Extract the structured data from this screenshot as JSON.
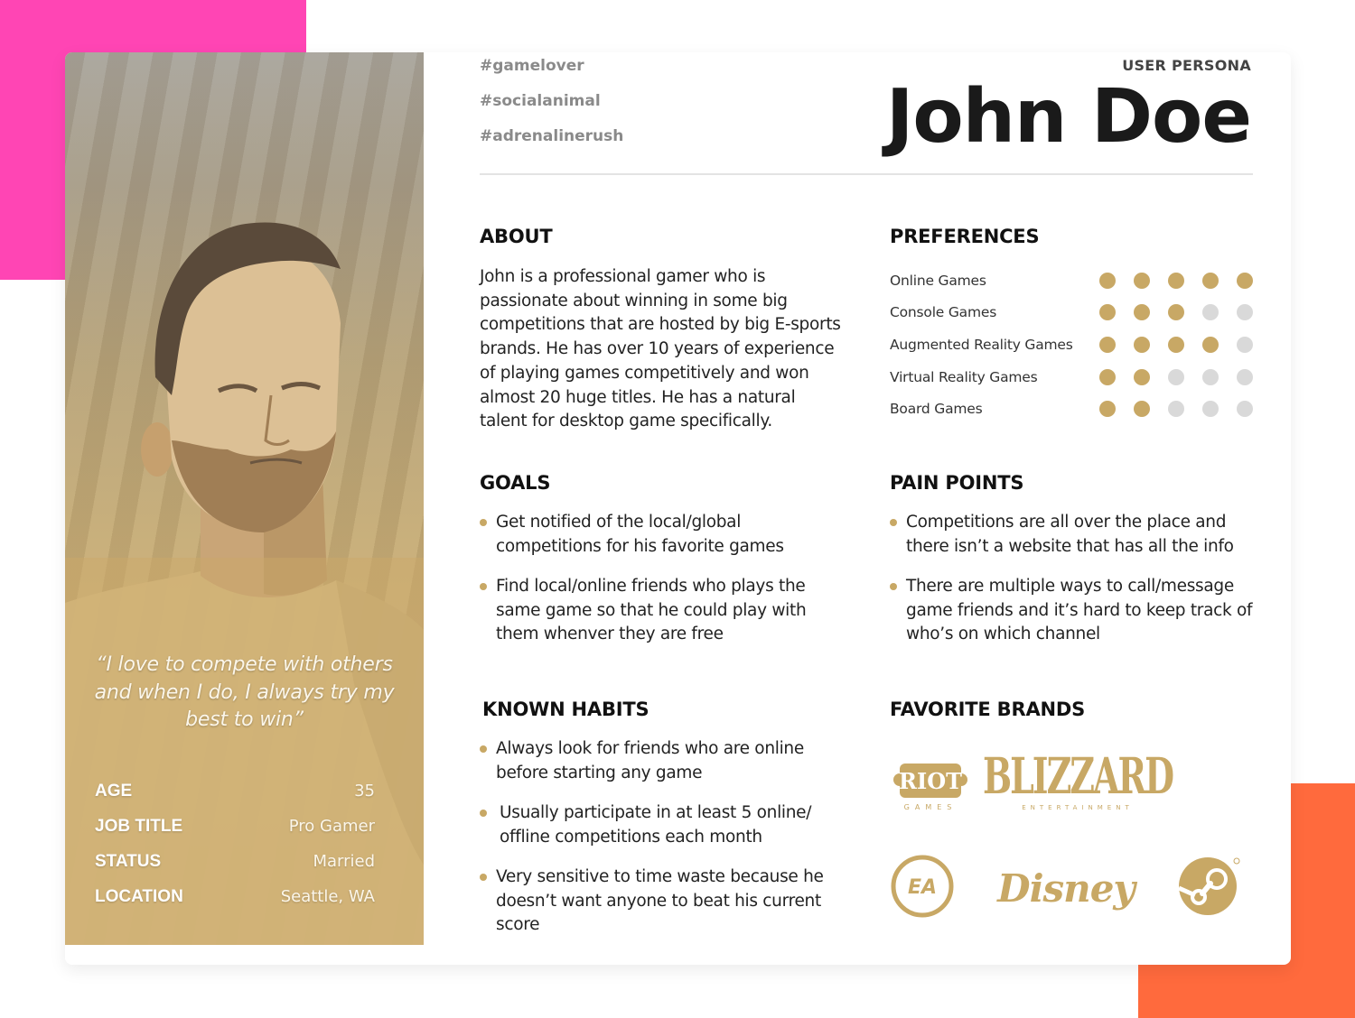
{
  "colors": {
    "accent": "#c8a865",
    "inactive_dot": "#d9d9d9",
    "deco_pink": "#ff45b4",
    "deco_orange": "#ff6a3d"
  },
  "header": {
    "label": "USER PERSONA",
    "name": "John Doe",
    "tags": [
      "#gamelover",
      "#socialanimal",
      "#adrenalinerush"
    ]
  },
  "profile": {
    "photo_alt": "portrait-photo",
    "quote": "“I love to compete with others and when I do, I always try my best to win”",
    "facts": [
      {
        "label": "AGE",
        "value": "35"
      },
      {
        "label": "JOB TITLE",
        "value": "Pro Gamer"
      },
      {
        "label": "STATUS",
        "value": "Married"
      },
      {
        "label": "LOCATION",
        "value": "Seattle, WA"
      }
    ]
  },
  "about": {
    "title": "ABOUT",
    "text": "John is a professional gamer who is passionate about winning in some big competitions that are hosted by big E-sports brands. He has over 10 years of experience of playing games competitively and won almost 20 huge titles. He has a natural talent for desktop game specifically."
  },
  "preferences": {
    "title": "PREFERENCES",
    "max": 5,
    "items": [
      {
        "label": "Online Games",
        "rating": 5
      },
      {
        "label": "Console Games",
        "rating": 3
      },
      {
        "label": "Augmented Reality Games",
        "rating": 4
      },
      {
        "label": "Virtual Reality Games",
        "rating": 2
      },
      {
        "label": "Board Games",
        "rating": 2
      }
    ]
  },
  "goals": {
    "title": "GOALS",
    "items": [
      "Get notified of the local/global competitions for his favorite games",
      "Find local/online friends who plays the same game so that he could play with them whenver they are free"
    ]
  },
  "pain_points": {
    "title": "PAIN POINTS",
    "items": [
      "Competitions are all over the place and there isn’t a website that has all the info",
      "There are multiple ways to call/message game friends and it’s hard to keep track of who’s on which channel"
    ]
  },
  "habits": {
    "title": "KNOWN HABITS",
    "items": [
      "Always look for friends who are online before starting any game",
      "Usually participate in at least 5 online/ offline competitions each month",
      "Very sensitive to time waste because he doesn’t want anyone to beat his current score"
    ]
  },
  "brands": {
    "title": "FAVORITE BRANDS",
    "items": [
      {
        "name": "Riot Games",
        "wordmark": "RIOT",
        "sub": "GAMES",
        "icon": "riot-games-logo"
      },
      {
        "name": "Blizzard Entertainment",
        "wordmark": "BLIZZARD",
        "sub": "ENTERTAINMENT",
        "icon": "blizzard-logo"
      },
      {
        "name": "EA",
        "wordmark": "EA",
        "icon": "ea-logo"
      },
      {
        "name": "Disney",
        "wordmark": "Disney",
        "icon": "disney-logo"
      },
      {
        "name": "Steam",
        "icon": "steam-logo"
      }
    ]
  }
}
